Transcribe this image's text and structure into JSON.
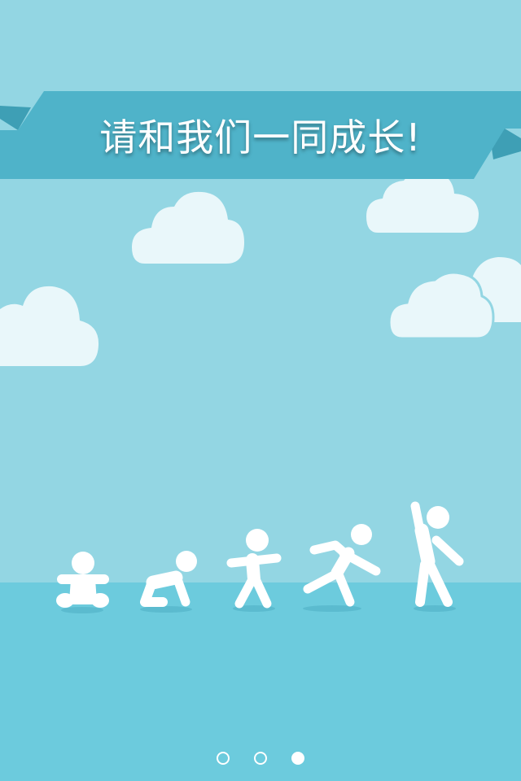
{
  "banner": {
    "title": "请和我们一同成长!"
  },
  "pager": {
    "pages": 3,
    "active_index": 2
  },
  "colors": {
    "sky": "#93d6e3",
    "ground": "#6ccbdd",
    "ribbon": "#4fb3c9",
    "ribbon_tail": "#3e9fb5",
    "cloud": "#e9f7fa",
    "figure": "#ffffff"
  },
  "illustration": {
    "figures": [
      "baby-sitting",
      "baby-crawling",
      "toddler-walking",
      "child-running",
      "adult-waving"
    ]
  }
}
